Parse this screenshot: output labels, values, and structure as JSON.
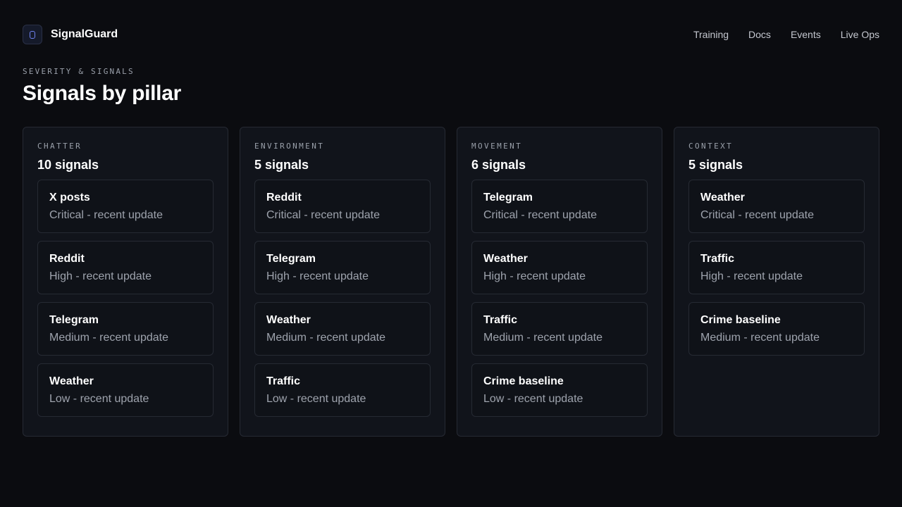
{
  "app": {
    "name": "SignalGuard",
    "logo_icon": "shield-icon"
  },
  "nav": [
    {
      "label": "Training"
    },
    {
      "label": "Docs"
    },
    {
      "label": "Events"
    },
    {
      "label": "Live Ops"
    }
  ],
  "page": {
    "eyebrow": "SEVERITY & SIGNALS",
    "title": "Signals by pillar"
  },
  "colors": {
    "background": "#0b0c10",
    "panel": "#11141b",
    "border": "#262a33",
    "accent": "#6f82f0"
  },
  "columns": [
    {
      "label": "CHATTER",
      "count": "10 signals",
      "cards": [
        {
          "title": "X posts",
          "sub": "Critical - recent update"
        },
        {
          "title": "Reddit",
          "sub": "High - recent update"
        },
        {
          "title": "Telegram",
          "sub": "Medium - recent update"
        },
        {
          "title": "Weather",
          "sub": "Low - recent update"
        }
      ]
    },
    {
      "label": "ENVIRONMENT",
      "count": "5 signals",
      "cards": [
        {
          "title": "Reddit",
          "sub": "Critical - recent update"
        },
        {
          "title": "Telegram",
          "sub": "High - recent update"
        },
        {
          "title": "Weather",
          "sub": "Medium - recent update"
        },
        {
          "title": "Traffic",
          "sub": "Low - recent update"
        }
      ]
    },
    {
      "label": "MOVEMENT",
      "count": "6 signals",
      "cards": [
        {
          "title": "Telegram",
          "sub": "Critical - recent update"
        },
        {
          "title": "Weather",
          "sub": "High - recent update"
        },
        {
          "title": "Traffic",
          "sub": "Medium - recent update"
        },
        {
          "title": "Crime baseline",
          "sub": "Low - recent update"
        }
      ]
    },
    {
      "label": "CONTEXT",
      "count": "5 signals",
      "cards": [
        {
          "title": "Weather",
          "sub": "Critical - recent update"
        },
        {
          "title": "Traffic",
          "sub": "High - recent update"
        },
        {
          "title": "Crime baseline",
          "sub": "Medium - recent update"
        }
      ]
    }
  ]
}
